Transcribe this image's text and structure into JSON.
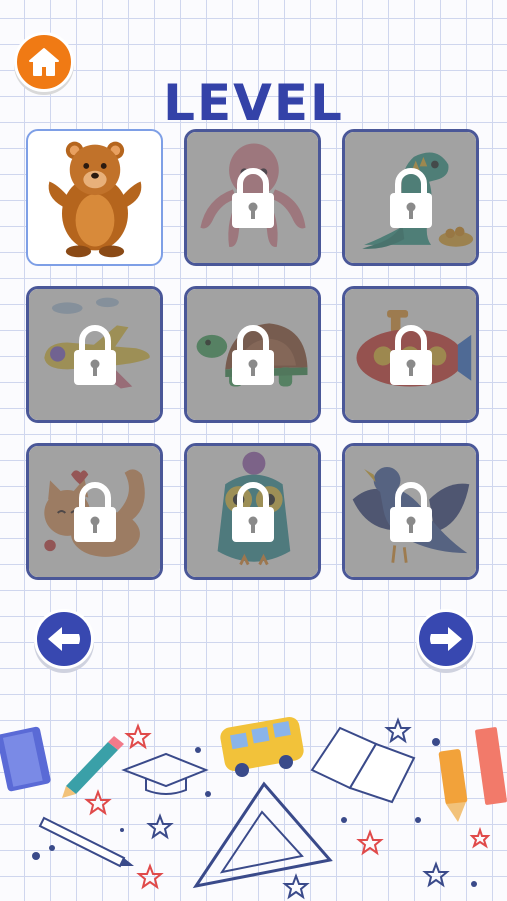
{
  "screen": {
    "title": "LEVEL"
  },
  "buttons": {
    "home_icon": "home-icon",
    "prev_icon": "arrow-left-icon",
    "next_icon": "arrow-right-icon"
  },
  "colors": {
    "accent": "#3442a8",
    "home": "#f07a14",
    "nav": "#3848b0",
    "grid_line": "#cfd6ee",
    "locked_overlay": "#5f5f5f",
    "tile_border": "#4a5798"
  },
  "levels": [
    {
      "picture": "bear",
      "locked": false
    },
    {
      "picture": "octopus",
      "locked": true
    },
    {
      "picture": "dinosaur",
      "locked": true
    },
    {
      "picture": "airplane",
      "locked": true
    },
    {
      "picture": "turtle",
      "locked": true
    },
    {
      "picture": "submarine",
      "locked": true
    },
    {
      "picture": "cat",
      "locked": true
    },
    {
      "picture": "owl",
      "locked": true
    },
    {
      "picture": "bird",
      "locked": true
    }
  ]
}
